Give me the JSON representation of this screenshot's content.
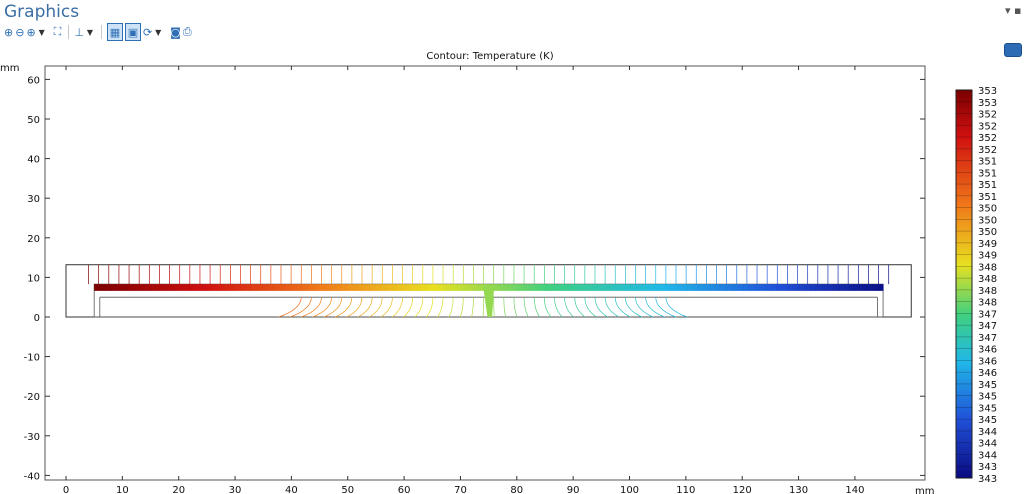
{
  "window": {
    "title": "Graphics",
    "pin_glyph": "▾ ▪"
  },
  "toolbar": [
    {
      "icon": "zoom-in-icon",
      "glyph": "⊕"
    },
    {
      "icon": "zoom-out-icon",
      "glyph": "⊖"
    },
    {
      "icon": "zoom-box-icon",
      "glyph": "⊕"
    },
    {
      "icon": "zoom-extents-icon",
      "glyph": "⛶"
    },
    {
      "icon": "view-axes-icon",
      "glyph": "⊥"
    },
    {
      "icon": "show-grid-icon",
      "glyph": "▦"
    },
    {
      "icon": "show-axis-icon",
      "glyph": "▣"
    },
    {
      "icon": "reset-view-icon",
      "glyph": "⟳"
    },
    {
      "icon": "camera-icon",
      "glyph": "◙"
    },
    {
      "icon": "print-icon",
      "glyph": "⎙"
    }
  ],
  "plot": {
    "title": "Contour: Temperature (K)",
    "x_unit": "mm",
    "y_unit": "mm"
  },
  "chart_data": {
    "type": "heatmap",
    "title": "Contour: Temperature (K)",
    "xlabel": "mm",
    "ylabel": "mm",
    "x_ticks": [
      0,
      10,
      20,
      30,
      40,
      50,
      60,
      70,
      80,
      90,
      100,
      110,
      120,
      130,
      140
    ],
    "y_ticks": [
      60,
      50,
      40,
      30,
      20,
      10,
      0,
      -10,
      -20,
      -30,
      -40
    ],
    "xlim": [
      -4,
      150
    ],
    "ylim": [
      -41,
      62
    ],
    "colorbar_labels": [
      "353",
      "353",
      "352",
      "352",
      "352",
      "352",
      "351",
      "351",
      "351",
      "351",
      "350",
      "350",
      "350",
      "349",
      "349",
      "348",
      "348",
      "348",
      "348",
      "347",
      "347",
      "347",
      "346",
      "346",
      "346",
      "345",
      "345",
      "345",
      "345",
      "344",
      "344",
      "344",
      "343",
      "343"
    ],
    "t_min": 343,
    "t_max": 353,
    "colormap": [
      "#7a0000",
      "#d01010",
      "#f07a1a",
      "#e8e020",
      "#40d080",
      "#20b8e8",
      "#2050d8",
      "#0a0a80"
    ],
    "geometry_outline": "rectangular plate 0–150 mm wide with top surface at ~13 mm, inner channel 5–145 mm from 5 to 8 mm",
    "hot_side": "left",
    "cold_side": "right",
    "junction_x": 75
  }
}
